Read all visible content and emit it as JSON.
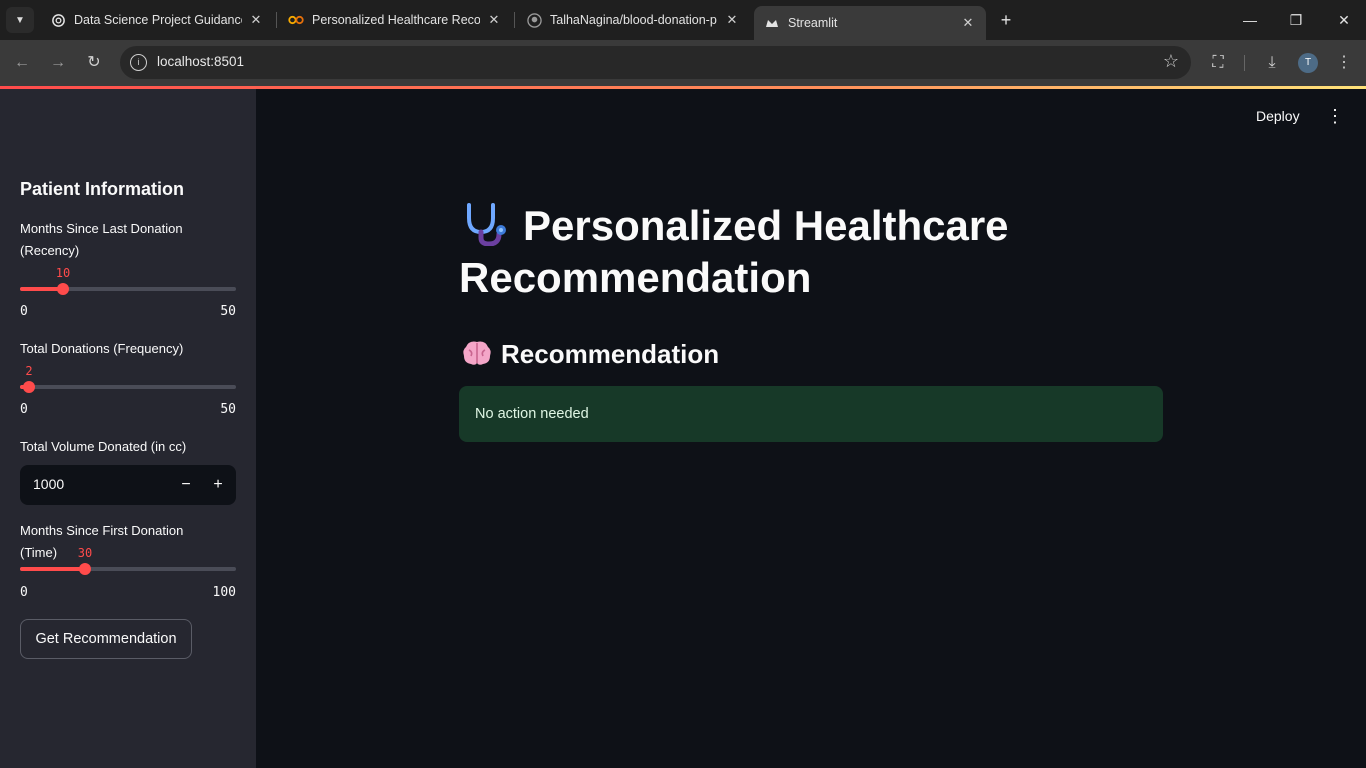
{
  "browser": {
    "tabs": [
      {
        "title": "Data Science Project Guidance",
        "favicon": "openai-icon"
      },
      {
        "title": "Personalized Healthcare Recomm",
        "favicon": "colab-icon"
      },
      {
        "title": "TalhaNagina/blood-donation-p",
        "favicon": "github-icon"
      },
      {
        "title": "Streamlit",
        "favicon": "streamlit-icon",
        "active": true
      }
    ],
    "url": "localhost:8501",
    "profile_initial": "T"
  },
  "header": {
    "deploy_label": "Deploy"
  },
  "sidebar": {
    "title": "Patient Information",
    "recency": {
      "label": "Months Since Last Donation (Recency)",
      "value": "10",
      "min": "0",
      "max": "50",
      "fraction": 0.2
    },
    "frequency": {
      "label": "Total Donations (Frequency)",
      "value": "2",
      "min": "0",
      "max": "50",
      "fraction": 0.04
    },
    "volume": {
      "label": "Total Volume Donated (in cc)",
      "value": "1000",
      "minus": "−",
      "plus": "+"
    },
    "time": {
      "label": "Months Since First Donation (Time)",
      "value": "30",
      "min": "0",
      "max": "100",
      "fraction": 0.3
    },
    "button_label": "Get Recommendation"
  },
  "main": {
    "title": "Personalized Healthcare Recommendation",
    "title_icon": "stethoscope-icon",
    "subheader": "Recommendation",
    "subheader_icon": "brain-icon",
    "result": "No action needed"
  },
  "colors": {
    "accent": "#ff4b4b",
    "sidebar_bg": "#262730",
    "main_bg": "#0e1117",
    "success_bg": "#173928"
  }
}
